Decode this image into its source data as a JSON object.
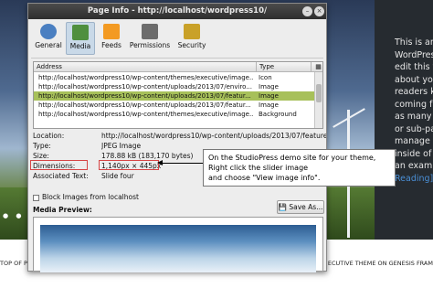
{
  "background_page": {
    "side_text_lines": [
      "This is an",
      "WordPress",
      "edit this t",
      "about you",
      "readers k",
      "coming fr",
      "as many p",
      "or sub-pa",
      "manage a",
      "inside of W",
      "an examp"
    ],
    "side_link": "Reading]",
    "footer_left": "TOP OF P",
    "footer_right": "ECUTIVE THEME ON GENESIS FRAM",
    "slider_dots": "● ● ●"
  },
  "window": {
    "title": "Page Info - http://localhost/wordpress10/",
    "controls": [
      "minimize",
      "close"
    ],
    "close_glyph": "×",
    "minimize_glyph": "–"
  },
  "toolbar": {
    "tabs": [
      {
        "label": "General",
        "icon": "info-icon",
        "active": false,
        "color": "#4a7fc1"
      },
      {
        "label": "Media",
        "icon": "media-icon",
        "active": true,
        "color": "#4f8f3f"
      },
      {
        "label": "Feeds",
        "icon": "rss-icon",
        "active": false,
        "color": "#f39a22"
      },
      {
        "label": "Permissions",
        "icon": "permissions-icon",
        "active": false,
        "color": "#6c6c6c"
      },
      {
        "label": "Security",
        "icon": "lock-icon",
        "active": false,
        "color": "#c9a128"
      }
    ]
  },
  "media_table": {
    "columns": [
      "Address",
      "Type"
    ],
    "rows": [
      {
        "address": "http://localhost/wordpress10/wp-content/themes/executive/image...",
        "type": "Icon",
        "selected": false
      },
      {
        "address": "http://localhost/wordpress10/wp-content/uploads/2013/07/enviro...",
        "type": "Image",
        "selected": false
      },
      {
        "address": "http://localhost/wordpress10/wp-content/uploads/2013/07/featur...",
        "type": "Image",
        "selected": true
      },
      {
        "address": "http://localhost/wordpress10/wp-content/uploads/2013/07/featur...",
        "type": "Image",
        "selected": false
      },
      {
        "address": "http://localhost/wordpress10/wp-content/themes/executive/image...",
        "type": "Background",
        "selected": false
      }
    ]
  },
  "details": {
    "location_label": "Location:",
    "location_value": "http://localhost/wordpress10/wp-content/uploads/2013/07/featured-3.",
    "type_label": "Type:",
    "type_value": "JPEG Image",
    "size_label": "Size:",
    "size_value": "178.88 kB (183,170 bytes)",
    "dimensions_label": "Dimensions:",
    "dimensions_value": "1,140px × 445px",
    "alt_label": "Associated Text:",
    "alt_value": "Slide four"
  },
  "block_images": {
    "label": "Block Images from localhost",
    "checked": false
  },
  "save_as_label": "Save As...",
  "media_preview_label": "Media Preview:",
  "callout": {
    "lines": [
      "On the StudioPress demo site for your theme,",
      "Right click the slider image",
      "and choose \"View image info\"."
    ]
  },
  "colors": {
    "selected_row": "#a7c05a",
    "highlight_box": "#d64545",
    "sidebar_bg": "#262b30",
    "link": "#4a8fd6"
  }
}
